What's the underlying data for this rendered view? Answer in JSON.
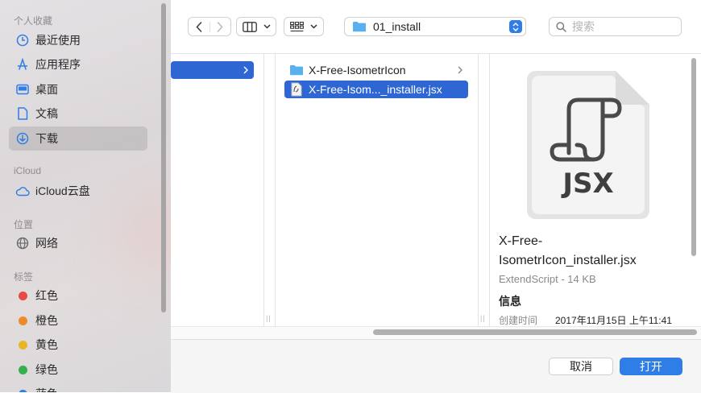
{
  "sidebar": {
    "favorites_header": "个人收藏",
    "favorites": [
      {
        "label": "最近使用",
        "icon": "clock-icon"
      },
      {
        "label": "应用程序",
        "icon": "applications-icon"
      },
      {
        "label": "桌面",
        "icon": "desktop-icon"
      },
      {
        "label": "文稿",
        "icon": "document-icon"
      },
      {
        "label": "下载",
        "icon": "download-icon",
        "selected": true
      }
    ],
    "icloud_header": "iCloud",
    "icloud_drive": "iCloud云盘",
    "locations_header": "位置",
    "network": "网络",
    "tags_header": "标签",
    "tags": [
      {
        "label": "红色",
        "color": "#e84b43"
      },
      {
        "label": "橙色",
        "color": "#ed8a2c"
      },
      {
        "label": "黄色",
        "color": "#e8b624"
      },
      {
        "label": "绿色",
        "color": "#33b24b"
      },
      {
        "label": "蓝色",
        "color": "#2f7de6"
      }
    ]
  },
  "toolbar": {
    "path_folder": "01_install",
    "search_placeholder": "搜索"
  },
  "browser": {
    "column2": [
      {
        "name": "X-Free-IsometrIcon",
        "type": "folder",
        "has_children": true
      },
      {
        "name": "X-Free-Isom..._installer.jsx",
        "type": "jsx-file",
        "selected": true
      }
    ],
    "preview": {
      "badge": "JSX",
      "filename_line1": "X-Free-",
      "filename_line2": "IsometrIcon_installer.jsx",
      "kind_size": "ExtendScript - 14 KB",
      "info_header": "信息",
      "created_label": "创建时间",
      "created_value": "2017年11月15日 上午11:41"
    }
  },
  "footer": {
    "cancel": "取消",
    "open": "打开"
  },
  "colors": {
    "accent": "#2e67d3",
    "primary_button": "#2f7de6",
    "folder": "#5ab0ef"
  }
}
